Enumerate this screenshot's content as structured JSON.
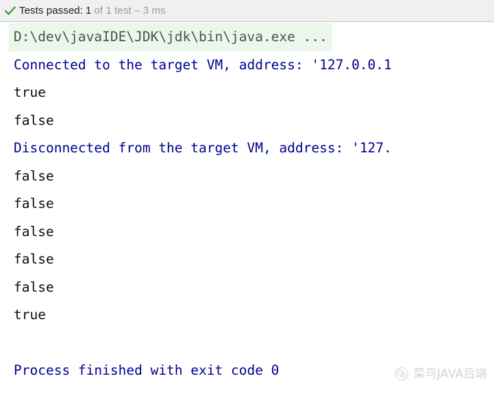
{
  "test_status": {
    "icon": "check-icon",
    "icon_color": "#4ea24e",
    "label": "Tests passed:",
    "passed_count": "1",
    "detail": "of 1 test – 3 ms",
    "background": "#f0f0f0"
  },
  "console": {
    "background": "#ffffff",
    "command_highlight_color": "#eaf7ea",
    "info_color": "#00008f",
    "plain_color": "#0c0c0c",
    "command_text_color": "#4f4f4f",
    "lines": [
      {
        "kind": "command",
        "text": "D:\\dev\\javaIDE\\JDK\\jdk\\bin\\java.exe ..."
      },
      {
        "kind": "info",
        "text": "Connected to the target VM, address: '127.0.0.1"
      },
      {
        "kind": "plain",
        "text": "true"
      },
      {
        "kind": "plain",
        "text": "false"
      },
      {
        "kind": "info",
        "text": "Disconnected from the target VM, address: '127."
      },
      {
        "kind": "plain",
        "text": "false"
      },
      {
        "kind": "plain",
        "text": "false"
      },
      {
        "kind": "plain",
        "text": "false"
      },
      {
        "kind": "plain",
        "text": "false"
      },
      {
        "kind": "plain",
        "text": "false"
      },
      {
        "kind": "plain",
        "text": "true"
      },
      {
        "kind": "blank",
        "text": ""
      },
      {
        "kind": "info",
        "text": "Process finished with exit code 0"
      }
    ]
  },
  "watermark": {
    "icon": "wechat-account-logo",
    "text": "菜鸟JAVA后端"
  }
}
